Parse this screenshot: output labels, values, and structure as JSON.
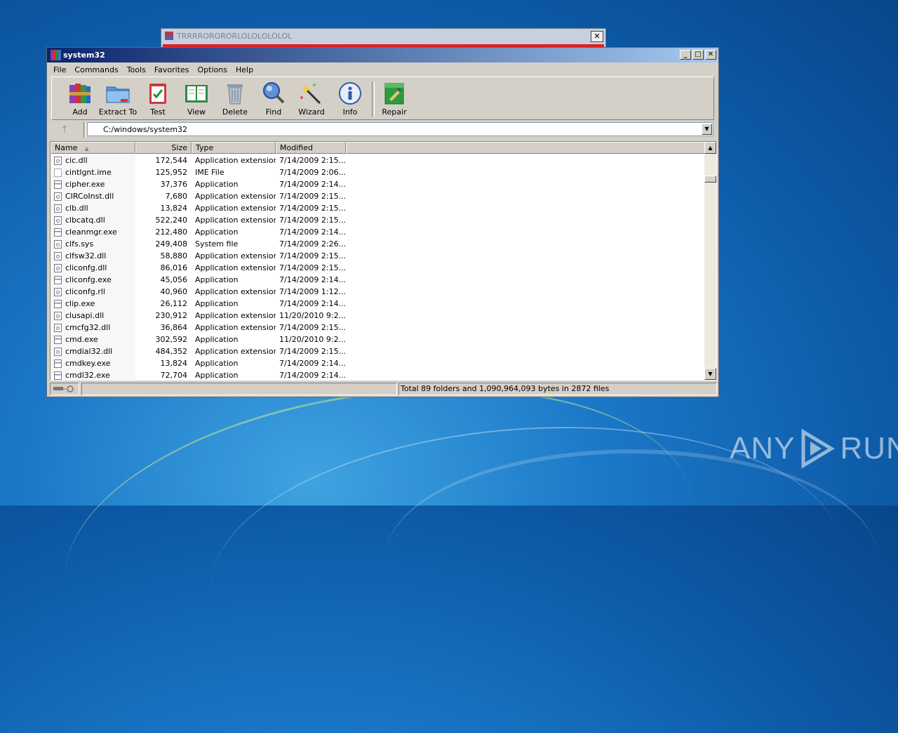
{
  "background_dialog": {
    "title": "TRRRRORORORLOLOLOLOLOL",
    "close_label": "✕"
  },
  "window": {
    "title": "system32",
    "controls": {
      "minimize": "_",
      "maximize": "□",
      "close": "✕"
    }
  },
  "menu": [
    "File",
    "Commands",
    "Tools",
    "Favorites",
    "Options",
    "Help"
  ],
  "toolbar": [
    {
      "label": "Add",
      "icon": "winrar-books-icon"
    },
    {
      "label": "Extract To",
      "icon": "folder-icon"
    },
    {
      "label": "Test",
      "icon": "clipboard-check-icon"
    },
    {
      "label": "View",
      "icon": "book-icon"
    },
    {
      "label": "Delete",
      "icon": "trash-icon"
    },
    {
      "label": "Find",
      "icon": "magnifier-icon"
    },
    {
      "label": "Wizard",
      "icon": "magic-wand-icon"
    },
    {
      "label": "Info",
      "icon": "info-icon"
    },
    {
      "label": "Repair",
      "icon": "repair-kit-icon"
    }
  ],
  "address": {
    "up_label": "↑",
    "path": "C:/windows/system32"
  },
  "columns": {
    "name": "Name",
    "size": "Size",
    "type": "Type",
    "modified": "Modified"
  },
  "files": [
    {
      "name": "cic.dll",
      "size": "172,544",
      "type": "Application extension",
      "modified": "7/14/2009 2:15...",
      "kind": "dll"
    },
    {
      "name": "cintlgnt.ime",
      "size": "125,952",
      "type": "IME File",
      "modified": "7/14/2009 2:06...",
      "kind": "ime"
    },
    {
      "name": "cipher.exe",
      "size": "37,376",
      "type": "Application",
      "modified": "7/14/2009 2:14...",
      "kind": "exe"
    },
    {
      "name": "CIRCoInst.dll",
      "size": "7,680",
      "type": "Application extension",
      "modified": "7/14/2009 2:15...",
      "kind": "dll"
    },
    {
      "name": "clb.dll",
      "size": "13,824",
      "type": "Application extension",
      "modified": "7/14/2009 2:15...",
      "kind": "dll"
    },
    {
      "name": "clbcatq.dll",
      "size": "522,240",
      "type": "Application extension",
      "modified": "7/14/2009 2:15...",
      "kind": "dll"
    },
    {
      "name": "cleanmgr.exe",
      "size": "212,480",
      "type": "Application",
      "modified": "7/14/2009 2:14...",
      "kind": "exe"
    },
    {
      "name": "clfs.sys",
      "size": "249,408",
      "type": "System file",
      "modified": "7/14/2009 2:26...",
      "kind": "sys"
    },
    {
      "name": "clfsw32.dll",
      "size": "58,880",
      "type": "Application extension",
      "modified": "7/14/2009 2:15...",
      "kind": "dll"
    },
    {
      "name": "cliconfg.dll",
      "size": "86,016",
      "type": "Application extension",
      "modified": "7/14/2009 2:15...",
      "kind": "dll"
    },
    {
      "name": "cliconfg.exe",
      "size": "45,056",
      "type": "Application",
      "modified": "7/14/2009 2:14...",
      "kind": "exe"
    },
    {
      "name": "cliconfg.rll",
      "size": "40,960",
      "type": "Application extension",
      "modified": "7/14/2009 1:12...",
      "kind": "dll"
    },
    {
      "name": "clip.exe",
      "size": "26,112",
      "type": "Application",
      "modified": "7/14/2009 2:14...",
      "kind": "exe"
    },
    {
      "name": "clusapi.dll",
      "size": "230,912",
      "type": "Application extension",
      "modified": "11/20/2010 9:2...",
      "kind": "dll"
    },
    {
      "name": "cmcfg32.dll",
      "size": "36,864",
      "type": "Application extension",
      "modified": "7/14/2009 2:15...",
      "kind": "dll"
    },
    {
      "name": "cmd.exe",
      "size": "302,592",
      "type": "Application",
      "modified": "11/20/2010 9:2...",
      "kind": "exe"
    },
    {
      "name": "cmdial32.dll",
      "size": "484,352",
      "type": "Application extension",
      "modified": "7/14/2009 2:15...",
      "kind": "dll"
    },
    {
      "name": "cmdkey.exe",
      "size": "13,824",
      "type": "Application",
      "modified": "7/14/2009 2:14...",
      "kind": "exe"
    },
    {
      "name": "cmdl32.exe",
      "size": "72,704",
      "type": "Application",
      "modified": "7/14/2009 2:14...",
      "kind": "exe"
    }
  ],
  "status": {
    "summary": "Total 89 folders and 1,090,964,093 bytes in 2872 files"
  },
  "watermark": {
    "left": "ANY",
    "right": "RUN"
  },
  "colors": {
    "titlebar_start": "#0a246a",
    "titlebar_end": "#a6caf0",
    "desktop": "#1b78c8",
    "alert_bar": "#e02020"
  }
}
